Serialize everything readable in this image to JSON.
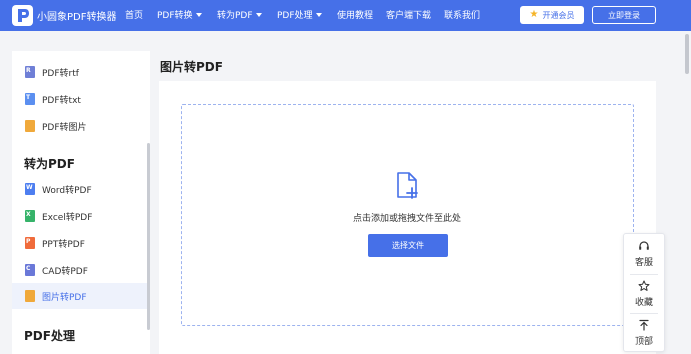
{
  "header": {
    "brand": "小圆象PDF转换器",
    "nav": [
      {
        "label": "首页",
        "dropdown": false
      },
      {
        "label": "PDF转换",
        "dropdown": true
      },
      {
        "label": "转为PDF",
        "dropdown": true
      },
      {
        "label": "PDF处理",
        "dropdown": true
      },
      {
        "label": "使用教程",
        "dropdown": false
      },
      {
        "label": "客户端下载",
        "dropdown": false
      },
      {
        "label": "联系我们",
        "dropdown": false
      }
    ],
    "vip_label": "开通会员",
    "login_label": "立即登录"
  },
  "sidebar": {
    "items_top": [
      {
        "label": "PDF转rtf",
        "icon": "rtf-file-icon",
        "color": "#6f7fd6",
        "glyph": "R"
      },
      {
        "label": "PDF转txt",
        "icon": "txt-file-icon",
        "color": "#5b8ff0",
        "glyph": "T"
      },
      {
        "label": "PDF转图片",
        "icon": "image-file-icon",
        "color": "#f0a93b",
        "glyph": ""
      }
    ],
    "section_convert": "转为PDF",
    "items_convert": [
      {
        "label": "Word转PDF",
        "icon": "word-file-icon",
        "color": "#4d7ef0",
        "glyph": "W",
        "active": false
      },
      {
        "label": "Excel转PDF",
        "icon": "excel-file-icon",
        "color": "#36b36a",
        "glyph": "X",
        "active": false
      },
      {
        "label": "PPT转PDF",
        "icon": "ppt-file-icon",
        "color": "#f06b3b",
        "glyph": "P",
        "active": false
      },
      {
        "label": "CAD转PDF",
        "icon": "cad-file-icon",
        "color": "#6a78d8",
        "glyph": "C",
        "active": false
      },
      {
        "label": "图片转PDF",
        "icon": "image-file-icon",
        "color": "#f0a93b",
        "glyph": "",
        "active": true
      }
    ],
    "section_process": "PDF处理"
  },
  "main": {
    "title": "图片转PDF",
    "drop_text": "点击添加或拖拽文件至此处",
    "choose_button": "选择文件"
  },
  "float_bar": {
    "items": [
      {
        "label": "客服",
        "icon": "headset-icon"
      },
      {
        "label": "收藏",
        "icon": "star-icon"
      },
      {
        "label": "顶部",
        "icon": "back-to-top-icon"
      }
    ]
  },
  "colors": {
    "accent": "#4670e8",
    "page_background": "#f3f4f7"
  }
}
